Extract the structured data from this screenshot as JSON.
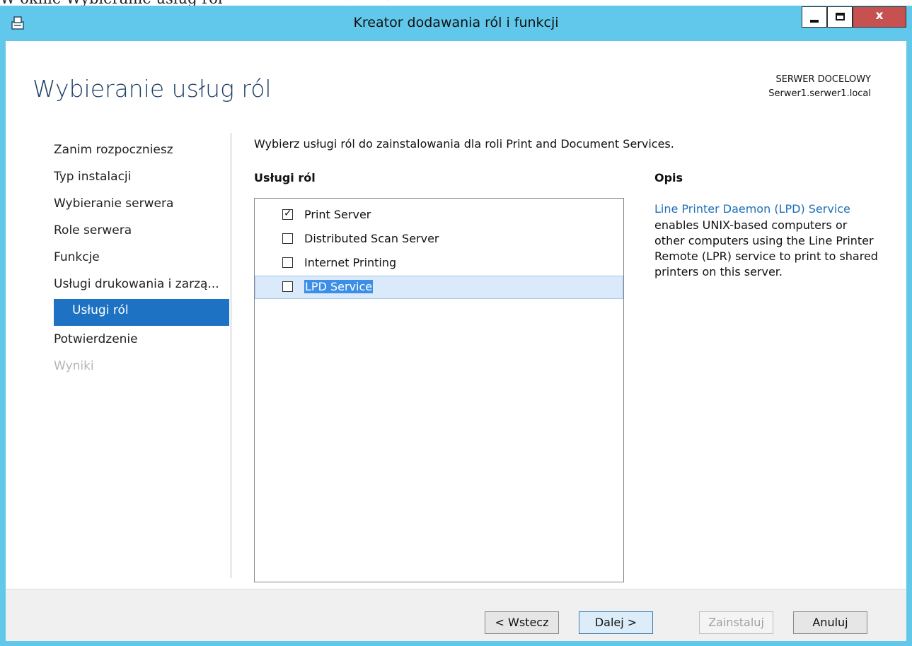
{
  "doc_fragment": {
    "left_text": "W oknie Wybieranie usług ról",
    "right_text": "≡ ▼ ≡ ▼"
  },
  "window": {
    "title": "Kreator dodawania ról i funkcji",
    "minimize_glyph": "",
    "maximize_glyph": "",
    "close_glyph": "x",
    "icon": "server-manager-icon"
  },
  "page": {
    "title": "Wybieranie usług ról",
    "destination_label": "SERWER DOCELOWY",
    "destination_value": "Serwer1.serwer1.local"
  },
  "nav": {
    "items": [
      {
        "label": "Zanim rozpoczniesz",
        "state": "normal"
      },
      {
        "label": "Typ instalacji",
        "state": "normal"
      },
      {
        "label": "Wybieranie serwera",
        "state": "normal"
      },
      {
        "label": "Role serwera",
        "state": "normal"
      },
      {
        "label": "Funkcje",
        "state": "normal"
      },
      {
        "label": "Usługi drukowania i zarzą...",
        "state": "normal"
      },
      {
        "label": "Usługi ról",
        "state": "selected"
      },
      {
        "label": "Potwierdzenie",
        "state": "normal"
      },
      {
        "label": "Wyniki",
        "state": "disabled"
      }
    ]
  },
  "main": {
    "intro": "Wybierz usługi ról do zainstalowania dla roli Print and Document Services.",
    "list_header": "Usługi ról",
    "services": [
      {
        "label": "Print Server",
        "checked": true,
        "highlighted": false
      },
      {
        "label": "Distributed Scan Server",
        "checked": false,
        "highlighted": false
      },
      {
        "label": "Internet Printing",
        "checked": false,
        "highlighted": false
      },
      {
        "label": "LPD Service",
        "checked": false,
        "highlighted": true
      }
    ],
    "description_header": "Opis",
    "description_link": "Line Printer Daemon (LPD) Service",
    "description_text": "enables UNIX-based computers or other computers using the Line Printer Remote (LPR) service to print to shared printers on this server."
  },
  "footer": {
    "back": "< Wstecz",
    "next": "Dalej >",
    "install": "Zainstaluj",
    "cancel": "Anuluj"
  },
  "colors": {
    "titlebar": "#61c8eb",
    "nav_selected": "#1e72c4",
    "link": "#1c6fb8",
    "close_button": "#c75050"
  }
}
